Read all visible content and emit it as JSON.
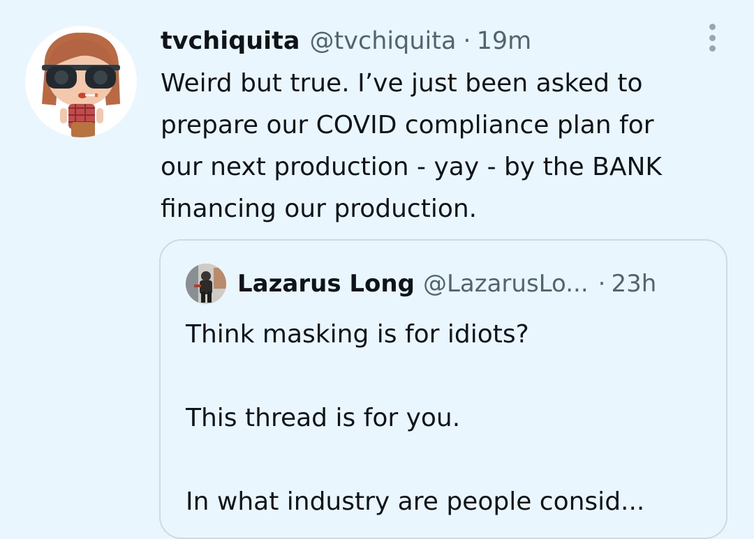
{
  "tweet": {
    "avatar_icon": "funko-avatar-icon",
    "display_name": "tvchiquita",
    "handle": "@tvchiquita",
    "separator": "·",
    "time": "19m",
    "more_icon": "more-vertical-icon",
    "text": "Weird but true. I’ve just been asked to\nprepare our COVID compliance plan for\nour next production - yay - by the BANK\nfinancing our production."
  },
  "quote": {
    "avatar_icon": "photo-avatar-icon",
    "display_name": "Lazarus Long",
    "handle": "@LazarusLo...",
    "separator": "·",
    "time": "23h",
    "paragraphs": [
      "Think masking is for idiots?",
      "This thread is for you.",
      "In what industry are people consid..."
    ]
  },
  "colors": {
    "background": "#e9f6fd",
    "text_primary": "#0f1419",
    "text_secondary": "#536471",
    "border": "#cfd9de"
  }
}
